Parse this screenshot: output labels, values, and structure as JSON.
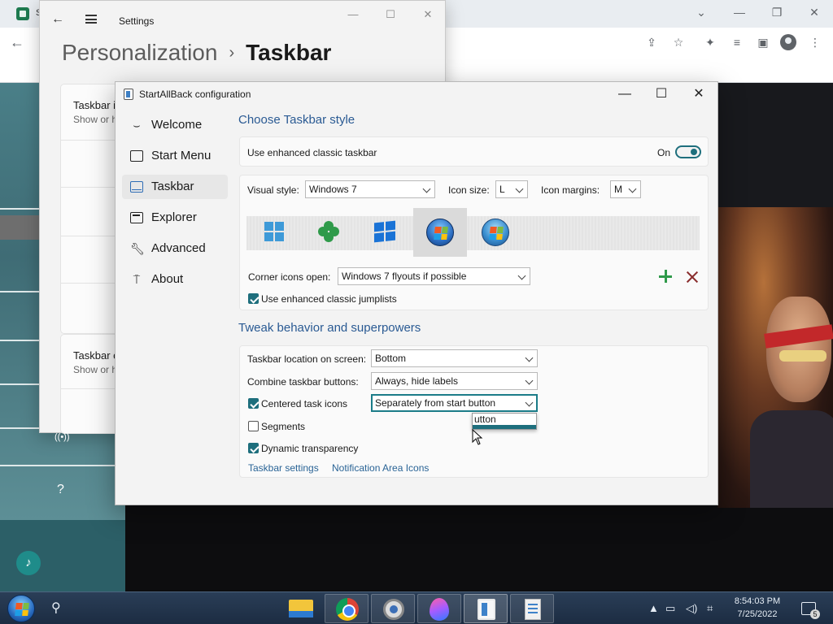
{
  "browser": {
    "tab_letter": "S",
    "controls": {
      "chevron": "⌄",
      "minimize": "—",
      "restore": "❐",
      "close": "✕"
    },
    "toolbar_icons": [
      "share-icon",
      "star-icon",
      "extensions-icon",
      "media-icon",
      "sidepanel-icon",
      "profile-icon",
      "menu-icon"
    ]
  },
  "settings_window": {
    "title": "Settings",
    "breadcrumb_parent": "Personalization",
    "breadcrumb_separator": "›",
    "breadcrumb_current": "Taskbar",
    "card1_title": "Taskbar i",
    "card1_sub": "Show or h",
    "card2_title": "Taskbar c",
    "card2_sub": "Show or h"
  },
  "sab_window": {
    "title": "StartAllBack configuration",
    "nav": [
      {
        "label": "Welcome",
        "icon": "smile-icon"
      },
      {
        "label": "Start Menu",
        "icon": "start-menu-icon"
      },
      {
        "label": "Taskbar",
        "icon": "taskbar-icon"
      },
      {
        "label": "Explorer",
        "icon": "folder-icon"
      },
      {
        "label": "Advanced",
        "icon": "wrench-icon"
      },
      {
        "label": "About",
        "icon": "about-icon"
      }
    ],
    "active_nav": "Taskbar",
    "taskbar_style": {
      "section_title": "Choose Taskbar style",
      "enhanced_label": "Use enhanced classic taskbar",
      "toggle_label": "On",
      "toggle_on": true,
      "visual_style_label": "Visual style:",
      "visual_style_value": "Windows 7",
      "icon_size_label": "Icon size:",
      "icon_size_value": "L",
      "icon_margins_label": "Icon margins:",
      "icon_margins_value": "M",
      "style_options": [
        "windows-11-logo",
        "clover-logo",
        "windows-10-logo",
        "windows-7-orb",
        "windows-vista-orb"
      ],
      "selected_style": "windows-7-orb",
      "corner_label": "Corner icons open:",
      "corner_value": "Windows 7 flyouts if possible",
      "jumplists_label": "Use enhanced classic jumplists",
      "jumplists_checked": true
    },
    "tweak": {
      "section_title": "Tweak behavior and superpowers",
      "location_label": "Taskbar location on screen:",
      "location_value": "Bottom",
      "combine_label": "Combine taskbar buttons:",
      "combine_value": "Always, hide labels",
      "centered_label": "Centered task icons",
      "centered_checked": true,
      "centered_value": "Separately from start button",
      "dropdown_option": "utton",
      "segments_label": "Segments",
      "segments_checked": false,
      "dynamic_label": "Dynamic transparency",
      "dynamic_checked": true,
      "link_taskbar_settings": "Taskbar settings",
      "link_notification_icons": "Notification Area Icons"
    }
  },
  "side_icons": {
    "wireless": "((•))",
    "help": "?"
  },
  "taskbar": {
    "apps": [
      "file-explorer",
      "chrome",
      "camera",
      "paint",
      "startallback",
      "configuration"
    ],
    "clock_time": "8:54:03 PM",
    "clock_date": "7/25/2022",
    "notification_count": "5"
  },
  "colors": {
    "accent": "#1e6f7d",
    "section_title": "#2a5a93",
    "link": "#2a6496",
    "add": "#2f9a4a",
    "remove": "#8a2e2e"
  }
}
